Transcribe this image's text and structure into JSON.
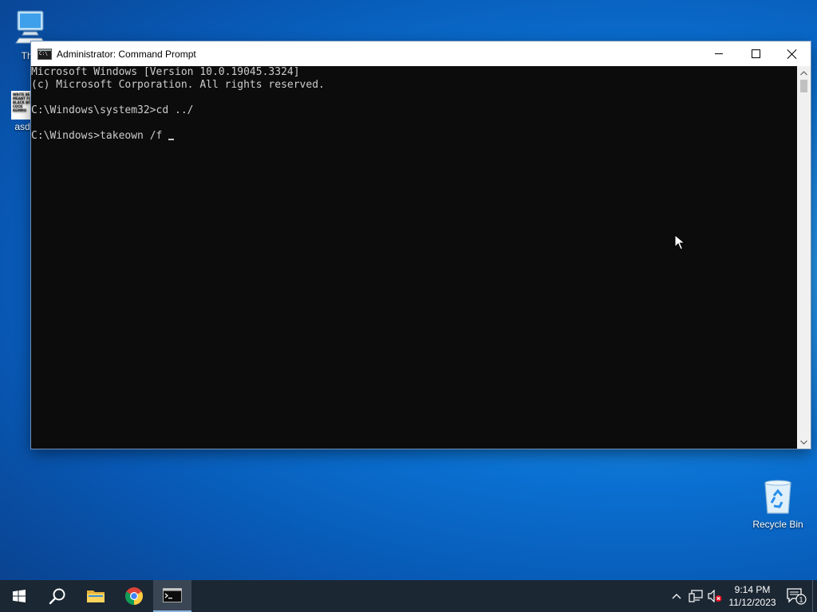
{
  "desktop": {
    "icons": [
      {
        "label": "This",
        "icon": "this-pc-icon"
      },
      {
        "label": "asd",
        "icon": "document-icon",
        "thumb_text": "WRITE BE MEANT FO BLACK BIT COCK REMMO"
      },
      {
        "label": "Recycle Bin",
        "icon": "recycle-bin-icon"
      }
    ]
  },
  "window": {
    "title": "Administrator: Command Prompt",
    "console_lines": [
      "Microsoft Windows [Version 10.0.19045.3324]",
      "(c) Microsoft Corporation. All rights reserved.",
      "",
      "C:\\Windows\\system32>cd ../",
      "",
      "C:\\Windows>takeown /f "
    ],
    "console_bg": "#0c0c0c",
    "console_fg": "#cccccc"
  },
  "taskbar": {
    "apps": [
      {
        "name": "start",
        "icon": "windows-logo-icon"
      },
      {
        "name": "search",
        "icon": "search-icon"
      },
      {
        "name": "file-explorer",
        "icon": "folder-icon"
      },
      {
        "name": "chrome",
        "icon": "chrome-icon"
      },
      {
        "name": "command-prompt",
        "icon": "cmd-icon",
        "active": true
      }
    ],
    "tray": {
      "time": "9:14 PM",
      "date": "11/12/2023",
      "notification_count": "1"
    },
    "bg": "#1b2733"
  }
}
